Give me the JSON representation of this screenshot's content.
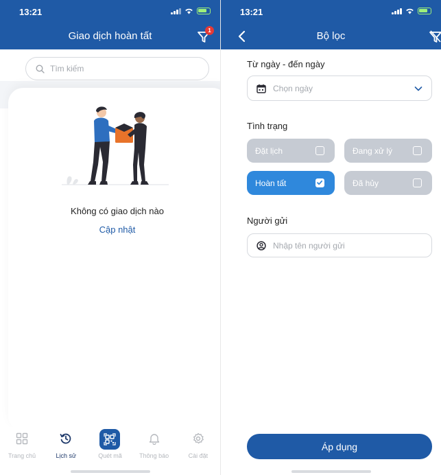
{
  "left": {
    "status": {
      "time": "13:21"
    },
    "header": {
      "title": "Giao dịch hoàn tất",
      "filter_badge": "1"
    },
    "search": {
      "placeholder": "Tìm kiếm"
    },
    "empty": {
      "message": "Không có giao dịch nào",
      "refresh": "Cập nhật"
    },
    "nav": {
      "items": [
        {
          "label": "Trang chủ",
          "icon": "grid-icon",
          "active": false
        },
        {
          "label": "Lịch sử",
          "icon": "history-icon",
          "active": true
        },
        {
          "label": "Quét mã",
          "icon": "qr-scan-icon",
          "active": false
        },
        {
          "label": "Thông báo",
          "icon": "bell-icon",
          "active": false
        },
        {
          "label": "Cài đặt",
          "icon": "gear-icon",
          "active": false
        }
      ]
    }
  },
  "right": {
    "status": {
      "time": "13:21"
    },
    "header": {
      "title": "Bộ lọc"
    },
    "date": {
      "label": "Từ ngày - đến ngày",
      "placeholder": "Chọn ngày"
    },
    "status_filter": {
      "label": "Tình trạng",
      "options": [
        {
          "label": "Đặt lịch",
          "checked": false
        },
        {
          "label": "Đang xử lý",
          "checked": false
        },
        {
          "label": "Hoàn tất",
          "checked": true
        },
        {
          "label": "Đã hủy",
          "checked": false
        }
      ]
    },
    "sender": {
      "label": "Người gửi",
      "placeholder": "Nhập tên người gửi"
    },
    "apply": {
      "label": "Áp dụng"
    }
  },
  "colors": {
    "primary": "#1f5aa6",
    "chip_active": "#2f88dc",
    "chip_inactive": "#c6cbd3",
    "badge": "#e53935"
  }
}
